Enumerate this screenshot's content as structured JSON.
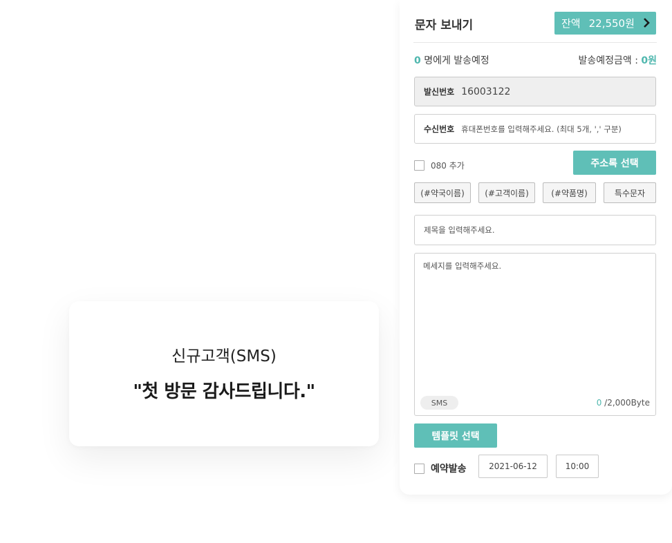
{
  "template_card": {
    "subtitle": "신규고객(SMS)",
    "message": "\"첫 방문 감사드립니다.\""
  },
  "panel": {
    "title": "문자 보내기",
    "balance": {
      "label": "잔액",
      "amount": "22,550원",
      "icon": "chevron-right-icon"
    },
    "recipient_count": "0",
    "recipient_suffix": "명에게 발송예정",
    "amount_label": "발송예정금액 :",
    "amount_value": "0원",
    "sender": {
      "label": "발신번호",
      "value": "16003122"
    },
    "receiver": {
      "label": "수신번호",
      "placeholder": "휴대폰번호를 입력해주세요. (최대 5개, ',' 구분)"
    },
    "optout_label": "080 추가",
    "address_button": "주소록 선택",
    "tags": [
      "(#약국이름)",
      "(#고객이름)",
      "(#약품명)",
      "특수문자"
    ],
    "subject_placeholder": "제목을 입력해주세요.",
    "message_placeholder": "메세지를 입력해주세요.",
    "msg_type": "SMS",
    "byte_used": "0",
    "byte_limit": "/2,000Byte",
    "template_button": "템플릿 선택",
    "reserve_label": "예약발송",
    "reserve_date": "2021-06-12",
    "reserve_time": "10:00"
  },
  "colors": {
    "accent": "#5fbfb7",
    "accent_text": "#4fb7ae"
  }
}
